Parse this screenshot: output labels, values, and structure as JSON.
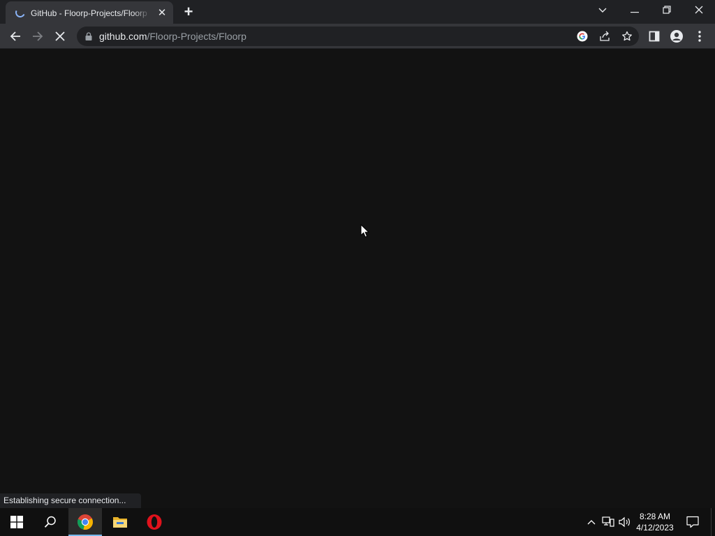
{
  "browser": {
    "tab": {
      "title": "GitHub - Floorp-Projects/Floorp"
    },
    "address_bar": {
      "host": "github.com",
      "path": "/Floorp-Projects/Floorp"
    },
    "status_text": "Establishing secure connection..."
  },
  "taskbar": {
    "pinned": [
      {
        "name": "start-icon"
      },
      {
        "name": "search-icon"
      },
      {
        "name": "chrome-icon",
        "active": true
      },
      {
        "name": "file-explorer-icon"
      },
      {
        "name": "opera-icon"
      }
    ],
    "clock": {
      "time": "8:28 AM",
      "date": "4/12/2023"
    }
  },
  "colors": {
    "page_bg": "#121212",
    "tabstrip_bg": "#202124",
    "toolbar_bg": "#35363a",
    "taskbar_bg": "#101010",
    "accent": "#8ab4f8"
  }
}
